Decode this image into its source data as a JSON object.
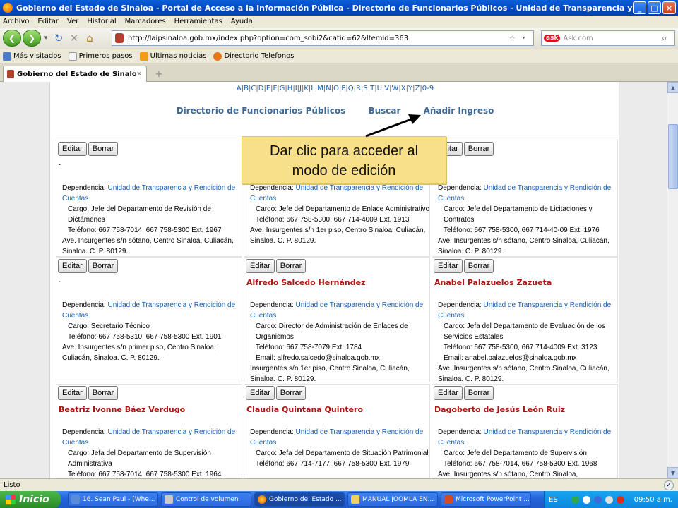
{
  "window": {
    "title": "Gobierno del Estado de Sinaloa - Portal de Acceso a la Información Pública - Directorio de Funcionarios Públicos - Unidad de Transparencia y Rendición de Cuentas - Mo..."
  },
  "menu": [
    "Archivo",
    "Editar",
    "Ver",
    "Historial",
    "Marcadores",
    "Herramientas",
    "Ayuda"
  ],
  "address": {
    "url": "http://laipsinaloa.gob.mx/index.php?option=com_sobi2&catid=62&Itemid=363"
  },
  "search": {
    "engine": "ask",
    "placeholder": "Ask.com"
  },
  "bookmarks": [
    "Más visitados",
    "Primeros pasos",
    "Últimas noticias",
    "Directorio Telefonos"
  ],
  "tab": {
    "title": "Gobierno del Estado de Sinaloa - Por..."
  },
  "page": {
    "alphabet": [
      "A",
      "B",
      "C",
      "D",
      "E",
      "F",
      "G",
      "H",
      "I",
      "J",
      "K",
      "L",
      "M",
      "N",
      "O",
      "P",
      "Q",
      "R",
      "S",
      "T",
      "U",
      "V",
      "W",
      "X",
      "Y",
      "Z",
      "0-9"
    ],
    "nav": [
      "Directorio de Funcionarios Públicos",
      "Buscar",
      "Añadir Ingreso"
    ],
    "edit_label": "Editar",
    "delete_label": "Borrar",
    "dep_label": "Dependencia:",
    "dep_value": "Unidad de Transparencia y Rendición de Cuentas"
  },
  "cards": [
    {
      "name": ".",
      "lines": [
        "Cargo: Jefe del Departamento de Revisión de Dictámenes",
        "Teléfono: 667 758-7014, 667 758-5300 Ext. 1967",
        "Ave. Insurgentes s/n sótano, Centro Sinaloa, Culiacán, Sinaloa. C. P. 80129."
      ]
    },
    {
      "name": "",
      "lines": [
        "Cargo: Jefe del Departamento de Enlace Administrativo",
        "Teléfono: 667 758-5300, 667 714-4009 Ext. 1913",
        "Ave. Insurgentes s/n 1er piso, Centro Sinaloa, Culiacán, Sinaloa. C. P. 80129."
      ]
    },
    {
      "name": "",
      "lines": [
        "Cargo: Jefe del Departamento de Licitaciones y Contratos",
        "Teléfono: 667 758-5300, 667 714-40-09 Ext. 1976",
        "Ave. Insurgentes s/n sótano, Centro Sinaloa, Culiacán, Sinaloa. C. P. 80129."
      ]
    },
    {
      "name": ".",
      "lines": [
        "Cargo: Secretario Técnico",
        "Teléfono: 667 758-5310, 667 758-5300 Ext. 1901",
        "Ave. Insurgentes s/n primer piso, Centro Sinaloa, Culiacán, Sinaloa. C. P. 80129."
      ]
    },
    {
      "name": "Alfredo Salcedo Hernández",
      "lines": [
        "Cargo: Director de Administración de Enlaces de Organismos",
        "Teléfono: 667 758-7079 Ext. 1784",
        "Email: alfredo.salcedo@sinaloa.gob.mx",
        "Insurgentes s/n 1er piso, Centro Sinaloa, Culiacán, Sinaloa. C. P. 80129."
      ]
    },
    {
      "name": "Anabel Palazuelos Zazueta",
      "lines": [
        "Cargo: Jefa del Departamento de Evaluación de los Servicios Estatales",
        "Teléfono: 667 758-5300, 667 714-4009 Ext. 3123",
        "Email: anabel.palazuelos@sinaloa.gob.mx",
        "Ave. Insurgentes s/n sótano, Centro Sinaloa, Culiacán, Sinaloa. C. P. 80129."
      ]
    },
    {
      "name": "Beatriz Ivonne Báez Verdugo",
      "lines": [
        "Cargo: Jefa del Departamento de Supervisión Administrativa",
        "Teléfono: 667 758-7014, 667 758-5300 Ext. 1964"
      ]
    },
    {
      "name": "Claudia Quintana Quintero",
      "lines": [
        "Cargo: Jefa del Departamento de Situación Patrimonial",
        "Teléfono: 667 714-7177, 667 758-5300 Ext. 1979"
      ]
    },
    {
      "name": "Dagoberto de Jesús León Ruiz",
      "lines": [
        "Cargo: Jefe del Departamento de Supervisión",
        "Teléfono: 667 758-7014, 667 758-5300 Ext. 1968",
        "Ave. Insurgentes s/n sótano, Centro Sinaloa,"
      ]
    }
  ],
  "callout": {
    "line1": "Dar clic para acceder al",
    "line2": "modo de edición"
  },
  "status": {
    "text": "Listo"
  },
  "taskbar": {
    "start": "Inicio",
    "tasks": [
      "16. Sean Paul - (Whe...",
      "Control de volumen",
      "Gobierno del Estado ...",
      "MANUAL JOOMLA EN...",
      "Microsoft PowerPoint ..."
    ],
    "lang": "ES",
    "clock": "09:50 a.m."
  }
}
